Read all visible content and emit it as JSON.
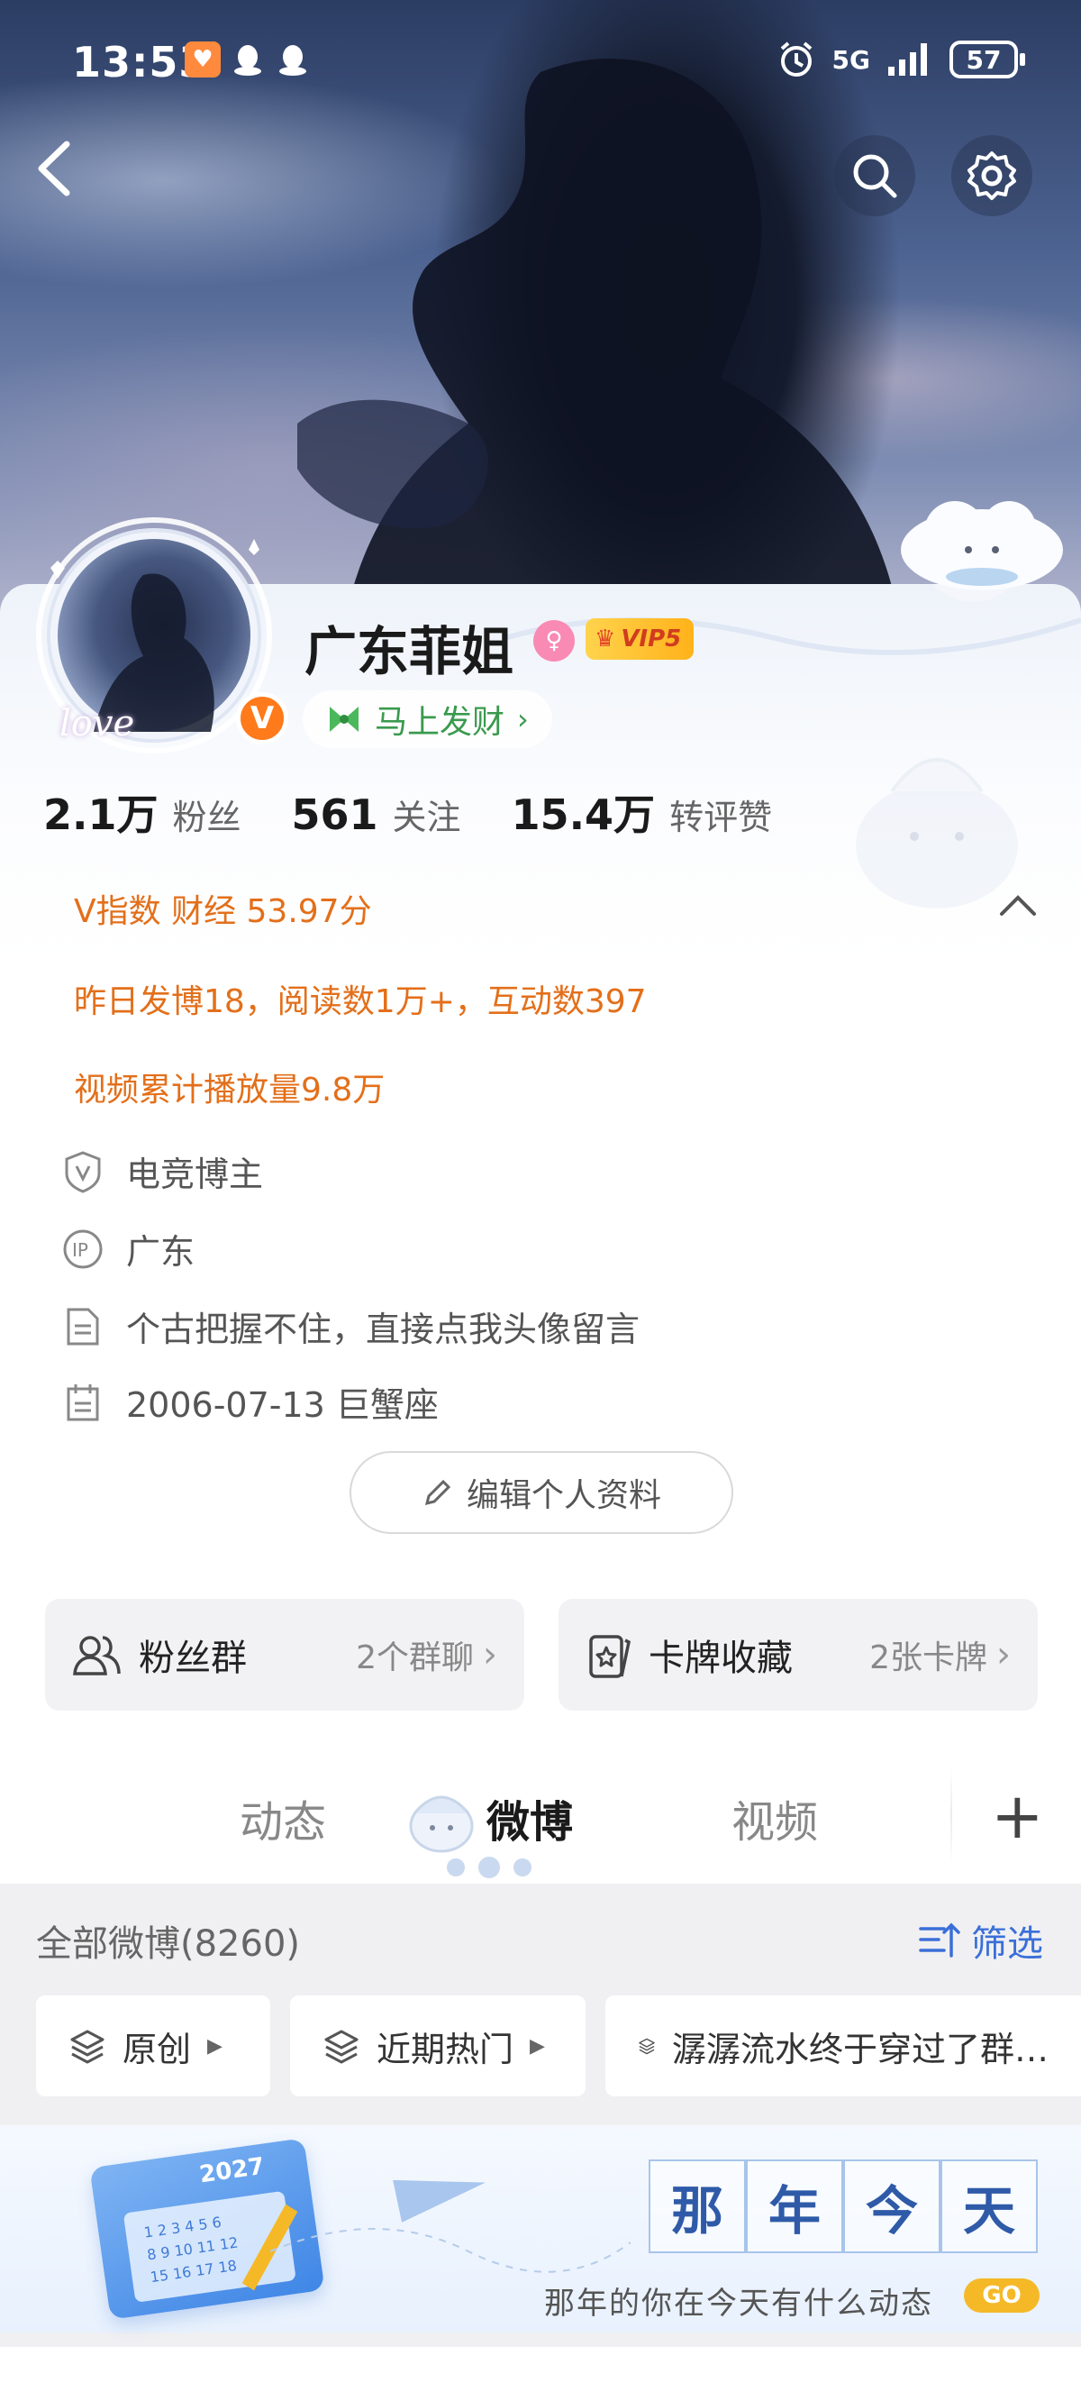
{
  "status_bar": {
    "time": "13:53",
    "network": "5G",
    "battery": "57",
    "icons": [
      "heart-app-icon",
      "qq-icon",
      "qq-icon",
      "alarm-icon",
      "signal-icon",
      "battery-icon"
    ]
  },
  "header": {
    "back_icon": "back-arrow-icon",
    "search_icon": "search-icon",
    "settings_icon": "gear-icon"
  },
  "profile": {
    "name": "广东菲姐",
    "vip_label": "VIP5",
    "avatar_text": "love",
    "verified_badge": "V",
    "fortune_label": "马上发财",
    "stats": [
      {
        "num": "2.1万",
        "label": "粉丝"
      },
      {
        "num": "561",
        "label": "关注"
      },
      {
        "num": "15.4万",
        "label": "转评赞"
      }
    ],
    "v_index": "V指数 财经 53.97分",
    "yesterday": "昨日发博18，阅读数1万+，互动数397",
    "video_plays": "视频累计播放量9.8万",
    "info": [
      {
        "icon": "v-shield-icon",
        "text": "电竞博主"
      },
      {
        "icon": "ip-icon",
        "text": "广东"
      },
      {
        "icon": "document-icon",
        "text": "个古把握不住，直接点我头像留言"
      },
      {
        "icon": "calendar-icon",
        "text": "2006-07-13 巨蟹座"
      }
    ],
    "edit_button": "编辑个人资料"
  },
  "tiles": [
    {
      "label": "粉丝群",
      "sub": "2个群聊",
      "icon": "group-icon"
    },
    {
      "label": "卡牌收藏",
      "sub": "2张卡牌",
      "icon": "card-icon"
    }
  ],
  "tabs": [
    {
      "label": "动态",
      "active": false
    },
    {
      "label": "微博",
      "active": true
    },
    {
      "label": "视频",
      "active": false
    }
  ],
  "feed": {
    "header": "全部微博(8260)",
    "filter": "筛选",
    "chips": [
      "原创",
      "近期热门",
      "潺潺流水终于穿过了群…"
    ]
  },
  "banner": {
    "title_chars": [
      "那",
      "年",
      "今",
      "天"
    ],
    "subtitle": "那年的你在今天有什么动态",
    "go": "GO",
    "calendar_year": "2027"
  },
  "colors": {
    "accent_orange": "#e36f1a",
    "link_blue": "#3a6fd8",
    "fortune_green": "#3a9a4d"
  }
}
